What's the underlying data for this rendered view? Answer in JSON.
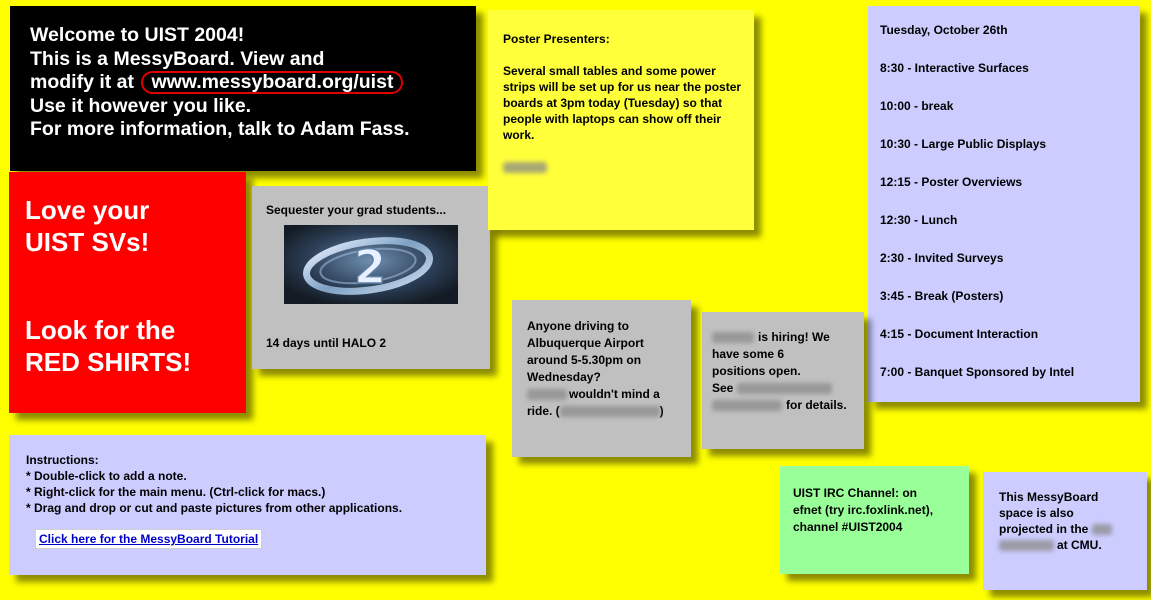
{
  "welcome": {
    "line1": "Welcome to UIST 2004!",
    "line2": "This is a MessyBoard. View and",
    "line3_prefix": "modify it at",
    "url": "www.messyboard.org/uist",
    "line4": "Use it however you like.",
    "line5": "For more information, talk to Adam Fass."
  },
  "svs": {
    "line1": "Love your",
    "line2": "UIST SVs!",
    "line3": "Look for the",
    "line4": "RED SHIRTS!"
  },
  "grad": {
    "title": "Sequester your grad students...",
    "image_text": "2",
    "caption": "14 days until HALO 2"
  },
  "poster": {
    "title": "Poster Presenters:",
    "body": "Several small tables and some power strips will be set up for us near the poster boards at 3pm today (Tuesday) so that people with laptops can show off their work."
  },
  "schedule": {
    "items": [
      "Tuesday, October 26th",
      "8:30 - Interactive Surfaces",
      "10:00 - break",
      "10:30 - Large Public Displays",
      "12:15 - Poster Overviews",
      "12:30 - Lunch",
      "2:30 - Invited Surveys",
      "3:45 - Break (Posters)",
      "4:15 - Document Interaction",
      "7:00 - Banquet Sponsored by Intel"
    ]
  },
  "airport": {
    "line1": "Anyone driving to",
    "line2": "Albuquerque Airport",
    "line3": "around 5-5.30pm on",
    "line4": "Wednesday?",
    "line5": "wouldn't mind a",
    "line6_prefix": "ride. (",
    "line6_suffix": ")"
  },
  "hiring": {
    "line1": "is hiring!  We",
    "line2": "have some 6",
    "line3": "positions open.",
    "line4": "See",
    "line5": "for details."
  },
  "instructions": {
    "title": "Instructions:",
    "lines": [
      "* Double-click to add a note.",
      "* Right-click for the main menu. (Ctrl-click for macs.)",
      "* Drag and drop or cut and paste pictures from other applications."
    ],
    "link": "Click here for the MessyBoard Tutorial"
  },
  "irc": {
    "line1": "UIST IRC Channel: on",
    "line2": "efnet (try irc.foxlink.net),",
    "line3": "channel #UIST2004"
  },
  "cmu": {
    "line1": "This MessyBoard",
    "line2": "space is also",
    "line3": "projected in the",
    "line4": "at CMU."
  },
  "colors": {
    "board": "#ffff00",
    "welcome_bg": "#000000",
    "svs_bg": "#ff0000",
    "gray_note": "#c0c0c0",
    "lavender_note": "#ccccff",
    "green_note": "#99ff99",
    "url_circle": "#e00000"
  }
}
